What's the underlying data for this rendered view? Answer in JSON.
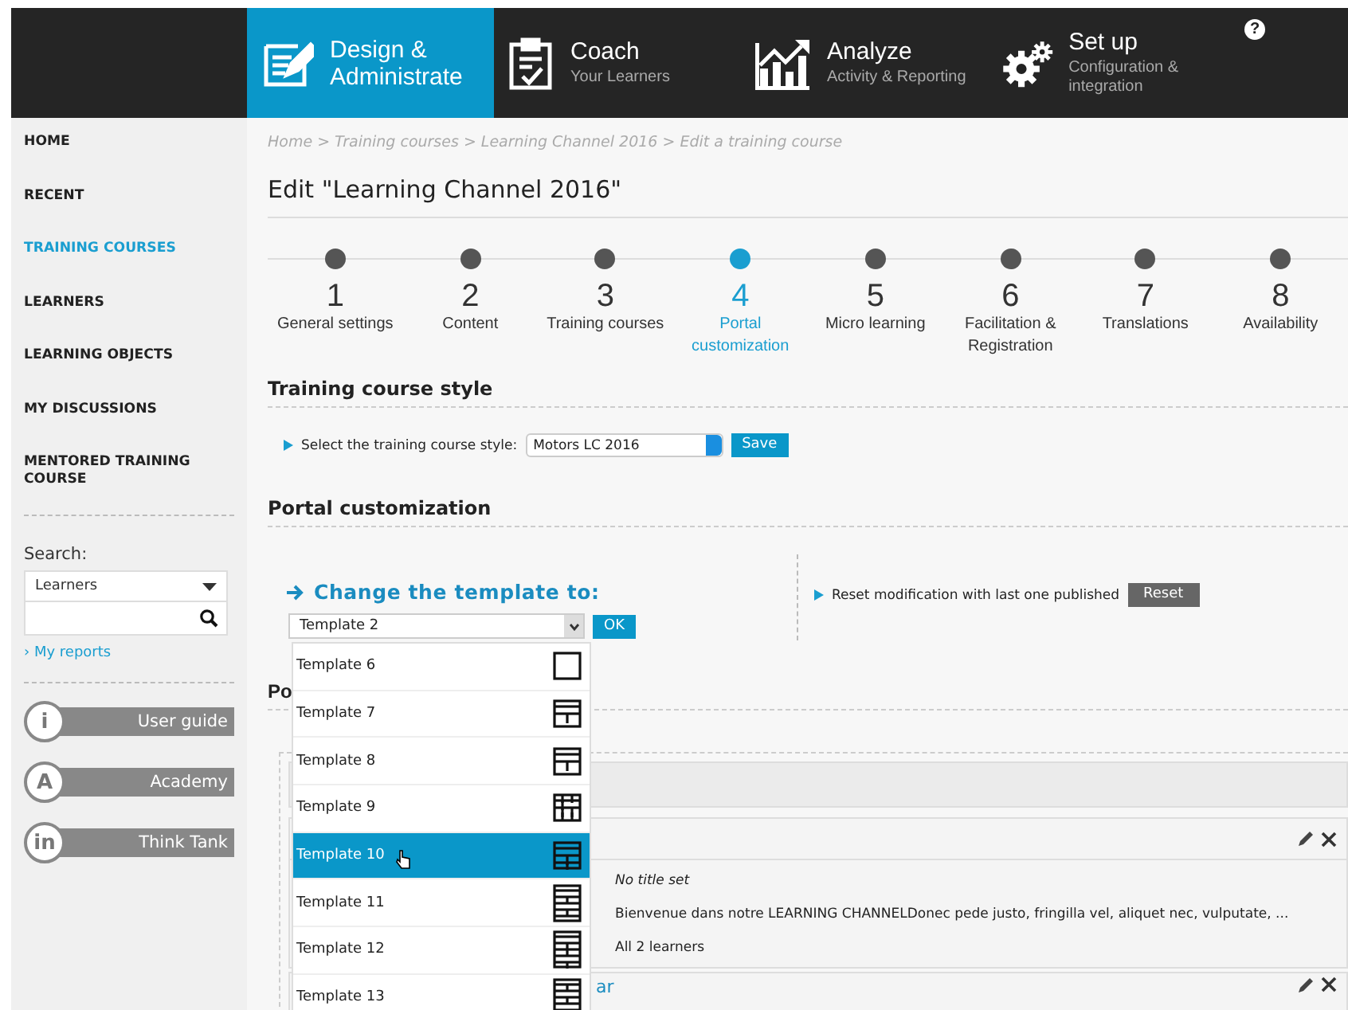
{
  "top_nav": {
    "tabs": [
      {
        "title": "Design & Administrate",
        "selected": true
      },
      {
        "title": "Coach",
        "subtitle": "Your Learners",
        "selected": false
      },
      {
        "title": "Analyze",
        "subtitle": "Activity & Reporting",
        "selected": false
      },
      {
        "title": "Set up",
        "subtitle": "Configuration & integration",
        "selected": false
      }
    ],
    "help": "?"
  },
  "sidebar": {
    "items": [
      {
        "label": "HOME",
        "selected": false
      },
      {
        "label": "RECENT",
        "selected": false
      },
      {
        "label": "TRAINING COURSES",
        "selected": true
      },
      {
        "label": "LEARNERS",
        "selected": false
      },
      {
        "label": "LEARNING OBJECTS",
        "selected": false
      },
      {
        "label": "MY DISCUSSIONS",
        "selected": false
      },
      {
        "label": "MENTORED TRAINING COURSE",
        "selected": false
      }
    ],
    "search_label": "Search:",
    "search_scope": "Learners",
    "reports_link": "› My reports",
    "resources": [
      {
        "badge": "i",
        "label": "User guide"
      },
      {
        "badge": "A",
        "label": "Academy"
      },
      {
        "badge": "in",
        "label": "Think Tank"
      }
    ]
  },
  "breadcrumb": "Home > Training courses > Learning Channel 2016 > Edit a training course",
  "title": "Edit \"Learning Channel 2016\"",
  "steps": [
    {
      "number": "1",
      "label": "General settings",
      "selected": false
    },
    {
      "number": "2",
      "label": "Content",
      "selected": false
    },
    {
      "number": "3",
      "label": "Training courses",
      "selected": false
    },
    {
      "number": "4",
      "label": "Portal customization",
      "selected": true
    },
    {
      "number": "5",
      "label": "Micro learning",
      "selected": false
    },
    {
      "number": "6",
      "label": "Facilitation & Registration",
      "selected": false
    },
    {
      "number": "7",
      "label": "Translations",
      "selected": false
    },
    {
      "number": "8",
      "label": "Availability",
      "selected": false
    }
  ],
  "style_section": {
    "heading": "Training course style",
    "prompt": "Select the training course style:",
    "value": "Motors LC 2016",
    "button": "Save"
  },
  "portal": {
    "heading": "Portal customization",
    "change_label": "Change the template to:",
    "template_value": "Template 2",
    "ok_button": "OK",
    "options": [
      {
        "label": "Template 6",
        "selected": false
      },
      {
        "label": "Template 7",
        "selected": false
      },
      {
        "label": "Template 8",
        "selected": false
      },
      {
        "label": "Template 9",
        "selected": false
      },
      {
        "label": "Template 10",
        "selected": true
      },
      {
        "label": "Template 11",
        "selected": false
      },
      {
        "label": "Template 12",
        "selected": false
      },
      {
        "label": "Template 13",
        "selected": false
      }
    ],
    "reset_prompt": "Reset modification with last one published",
    "reset_button": "Reset"
  },
  "hidden_heading": "Po",
  "card": {
    "caption": "No title set",
    "description": "Bienvenue dans notre LEARNING CHANNELDonec pede justo, fringilla vel, aliquet nec, vulputate, ...",
    "audience": "All 2 learners"
  },
  "next_card_title": "ar"
}
